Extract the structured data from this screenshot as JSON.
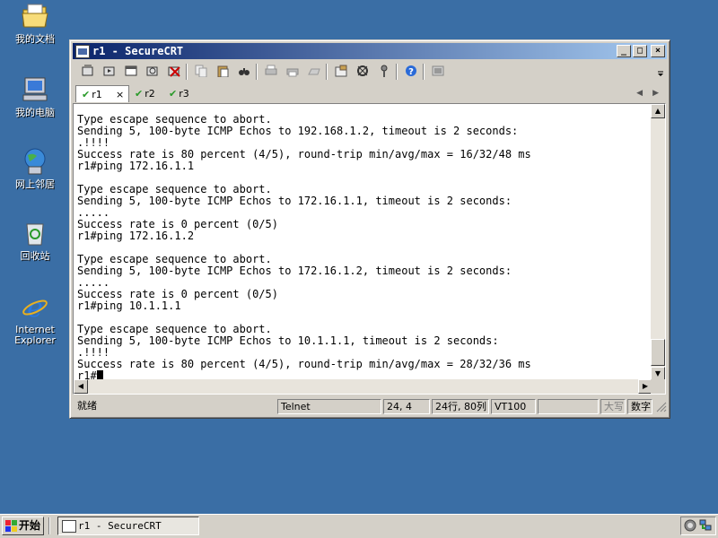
{
  "desktop": {
    "icons": [
      {
        "label": "我的文档",
        "icon": "my-documents-icon"
      },
      {
        "label": "我的电脑",
        "icon": "my-computer-icon"
      },
      {
        "label": "网上邻居",
        "icon": "network-places-icon"
      },
      {
        "label": "回收站",
        "icon": "recycle-bin-icon"
      },
      {
        "label": "Internet Explorer",
        "icon": "internet-explorer-icon"
      }
    ]
  },
  "window": {
    "title": "r1 - SecureCRT",
    "buttons": {
      "minimize": "_",
      "maximize": "□",
      "close": "×"
    },
    "toolbar_icons": [
      "connect-icon",
      "quick-connect-icon",
      "connect-tab-icon",
      "reconnect-icon",
      "disconnect-icon",
      "copy-icon",
      "paste-icon",
      "find-icon",
      "print-icon",
      "print-selection-icon",
      "print-setup-icon",
      "session-options-icon",
      "global-options-icon",
      "keymap-icon",
      "help-icon",
      "sftp-icon"
    ],
    "tabs": [
      {
        "label": "r1",
        "status": "✔",
        "close": "×",
        "active": true
      },
      {
        "label": "r2",
        "status": "✔",
        "active": false
      },
      {
        "label": "r3",
        "status": "✔",
        "active": false
      }
    ],
    "tab_nav": {
      "prev": "◀",
      "next": "▶"
    }
  },
  "terminal": {
    "lines": [
      "Type escape sequence to abort.",
      "Sending 5, 100-byte ICMP Echos to 192.168.1.2, timeout is 2 seconds:",
      ".!!!!",
      "Success rate is 80 percent (4/5), round-trip min/avg/max = 16/32/48 ms",
      "r1#ping 172.16.1.1",
      "",
      "Type escape sequence to abort.",
      "Sending 5, 100-byte ICMP Echos to 172.16.1.1, timeout is 2 seconds:",
      ".....",
      "Success rate is 0 percent (0/5)",
      "r1#ping 172.16.1.2",
      "",
      "Type escape sequence to abort.",
      "Sending 5, 100-byte ICMP Echos to 172.16.1.2, timeout is 2 seconds:",
      ".....",
      "Success rate is 0 percent (0/5)",
      "r1#ping 10.1.1.1",
      "",
      "Type escape sequence to abort.",
      "Sending 5, 100-byte ICMP Echos to 10.1.1.1, timeout is 2 seconds:",
      ".!!!!",
      "Success rate is 80 percent (4/5), round-trip min/avg/max = 28/32/36 ms"
    ],
    "prompt": "r1#"
  },
  "statusbar": {
    "ready": "就绪",
    "protocol": "Telnet",
    "cursor_pos": "24,  4",
    "size": "24行, 80列",
    "emulation": "VT100",
    "caps": "大写",
    "num": "数字"
  },
  "taskbar": {
    "start": "开始",
    "task": "r1 - SecureCRT"
  },
  "colors": {
    "desktop": "#3a6ea5",
    "titlebar_start": "#0a246a",
    "titlebar_end": "#a6caf0",
    "face": "#d4d0c8"
  }
}
